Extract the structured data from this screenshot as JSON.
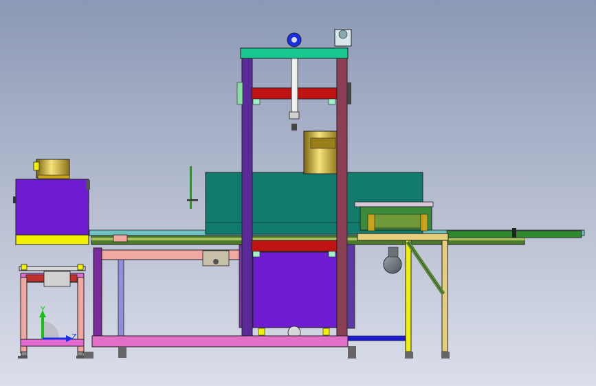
{
  "viewport": {
    "background_top": "#8c98b5",
    "background_bottom": "#dcdfea"
  },
  "triad": {
    "y_label": "Y",
    "z_label": "Z",
    "y_color": "#18c018",
    "z_color": "#1a2ee6"
  },
  "colors": {
    "frame_purple": "#5a2a9a",
    "frame_mauve": "#8a3f55",
    "housing_teal": "#137a6e",
    "beam_red": "#c01414",
    "top_plate": "#18c890",
    "salmon": "#f0a8a0",
    "tank_purple": "#6e1ccf",
    "gold": "#e2c23a",
    "yellow": "#f0f000",
    "table_tan": "#e6cf7a",
    "pink": "#e46ad2",
    "blue": "#1a1acc",
    "green_conveyor": "#2f8a2f"
  }
}
